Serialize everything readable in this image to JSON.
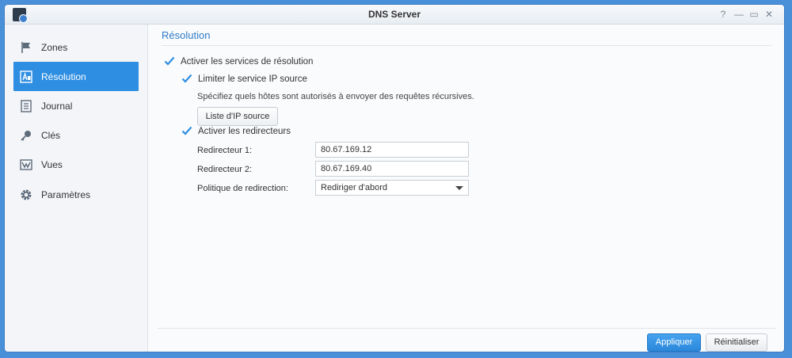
{
  "window": {
    "title": "DNS Server",
    "controls": [
      {
        "name": "help",
        "glyph": "?"
      },
      {
        "name": "minimize",
        "glyph": "—"
      },
      {
        "name": "maximize",
        "glyph": "▭"
      },
      {
        "name": "close",
        "glyph": "✕"
      }
    ]
  },
  "sidebar": {
    "items": [
      {
        "label": "Zones",
        "icon": "flag-icon",
        "active": false
      },
      {
        "label": "Résolution",
        "icon": "resolution-icon",
        "active": true
      },
      {
        "label": "Journal",
        "icon": "log-icon",
        "active": false
      },
      {
        "label": "Clés",
        "icon": "key-icon",
        "active": false
      },
      {
        "label": "Vues",
        "icon": "views-icon",
        "active": false
      },
      {
        "label": "Paramètres",
        "icon": "gear-icon",
        "active": false
      }
    ]
  },
  "main": {
    "section_title": "Résolution",
    "enable_resolution": {
      "label": "Activer les services de résolution",
      "checked": true
    },
    "limit_source": {
      "label": "Limiter le service IP source",
      "checked": true
    },
    "limit_description": "Spécifiez quels hôtes sont autorisés à envoyer des requêtes récursives.",
    "source_ip_list_button": "Liste d'IP source",
    "enable_forwarders": {
      "label": "Activer les redirecteurs",
      "checked": true
    },
    "forwarder1": {
      "label": "Redirecteur 1:",
      "value": "80.67.169.12"
    },
    "forwarder2": {
      "label": "Redirecteur 2:",
      "value": "80.67.169.40"
    },
    "policy": {
      "label": "Politique de redirection:",
      "value": "Rediriger d'abord"
    }
  },
  "footer": {
    "apply_label": "Appliquer",
    "reset_label": "Réinitialiser"
  },
  "colors": {
    "accent": "#2e8ee2",
    "title_blue": "#2e7bc8",
    "desktop": "#4a90d9"
  }
}
